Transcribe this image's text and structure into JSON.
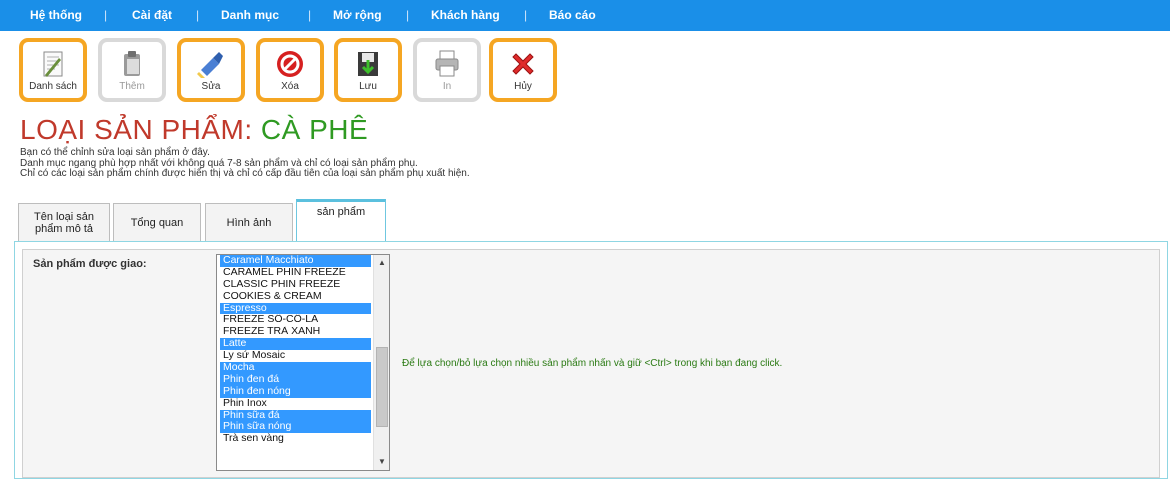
{
  "nav": {
    "items": [
      "Hệ thống",
      "Cài đặt",
      "Danh mục",
      "Mở rộng",
      "Khách hàng",
      "Báo cáo"
    ],
    "separator": "|"
  },
  "toolbar": {
    "list_label": "Danh sách",
    "add_label": "Thêm",
    "edit_label": "Sửa",
    "delete_label": "Xóa",
    "save_label": "Lưu",
    "print_label": "In",
    "cancel_label": "Hủy"
  },
  "page": {
    "title_prefix": "LOẠI SẢN PHẨM: ",
    "title_name": "CÀ PHÊ",
    "desc_lines": [
      "Bạn có thể chỉnh sửa loại sản phẩm ở đây.",
      "Danh mục ngang phù hợp nhất với không quá 7-8 sản phẩm và chỉ có loại sản phẩm phụ.",
      "Chỉ có các loại sản phẩm chính được hiển thị và chỉ có cấp đầu tiên của loại sản phẩm phụ xuất hiện."
    ]
  },
  "tabs": {
    "name_desc": "Tên loại sản phẩm mô tả",
    "overview": "Tổng quan",
    "images": "Hình ảnh",
    "products": "sản phẩm"
  },
  "form": {
    "assigned_label": "Sản phẩm được giao:",
    "hint": "Để lựa chọn/bỏ lựa chọn nhiều sản phẩm nhấn và giữ <Ctrl> trong khi bạn đang click.",
    "options": [
      {
        "label": "Caramel Macchiato",
        "selected": true
      },
      {
        "label": "CARAMEL PHIN FREEZE",
        "selected": false
      },
      {
        "label": "CLASSIC PHIN FREEZE",
        "selected": false
      },
      {
        "label": "COOKIES & CREAM",
        "selected": false
      },
      {
        "label": "Espresso",
        "selected": true
      },
      {
        "label": "FREEZE SÔ-CÔ-LA",
        "selected": false
      },
      {
        "label": "FREEZE TRÀ XANH",
        "selected": false
      },
      {
        "label": "Latte",
        "selected": true
      },
      {
        "label": "Ly sứ Mosaic",
        "selected": false
      },
      {
        "label": "Mocha",
        "selected": true
      },
      {
        "label": "Phin đen đá",
        "selected": true
      },
      {
        "label": "Phin đen nóng",
        "selected": true
      },
      {
        "label": "Phin Inox",
        "selected": false
      },
      {
        "label": "Phin sữa đá",
        "selected": true
      },
      {
        "label": "Phin sữa nóng",
        "selected": true
      },
      {
        "label": "Trà sen vàng",
        "selected": false
      }
    ]
  },
  "colors": {
    "nav_bg": "#1a8fe8",
    "tool_border": "#f5a623",
    "title_red": "#c0392b",
    "title_green": "#2f9a22",
    "selected_bg": "#3399ff"
  }
}
